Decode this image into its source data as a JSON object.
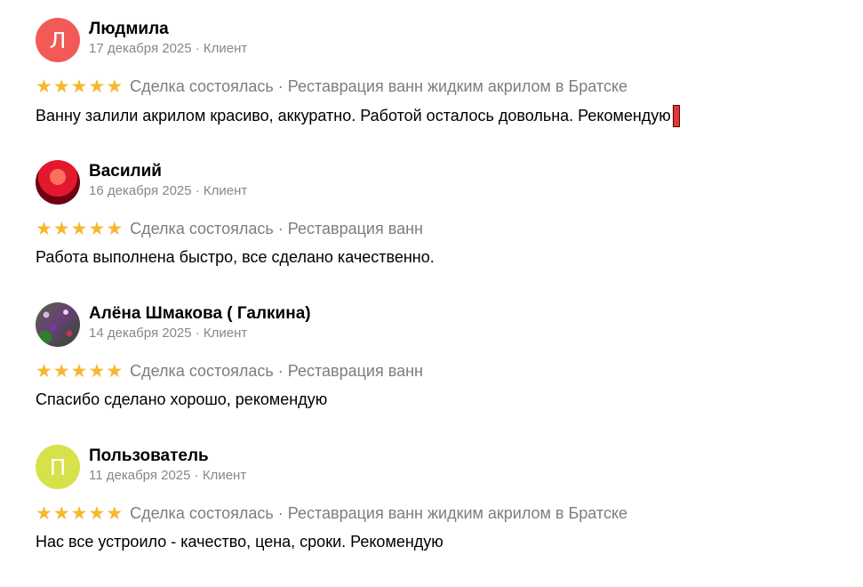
{
  "reviews": [
    {
      "avatar": {
        "type": "initial",
        "letter": "Л",
        "color": "#f25a57"
      },
      "author": "Людмила",
      "date": "17 декабря 2025",
      "role": "Клиент",
      "meta": "17 декабря 2025 · Клиент",
      "rating": 5,
      "stars": [
        "★",
        "★",
        "★",
        "★",
        "★"
      ],
      "deal": "Сделка состоялась · Реставрация ванн жидким акрилом в Братске",
      "text": "Ванну залили акрилом красиво, аккуратно. Работой осталось довольна. Рекомендую",
      "emoji": "red-exclamation-icon"
    },
    {
      "avatar": {
        "type": "photo",
        "icon": "user-photo-avatar",
        "color": "#d92029"
      },
      "author": "Василий",
      "date": "16 декабря 2025",
      "role": "Клиент",
      "meta": "16 декабря 2025 · Клиент",
      "rating": 5,
      "stars": [
        "★",
        "★",
        "★",
        "★",
        "★"
      ],
      "deal": "Сделка состоялась · Реставрация ванн",
      "text": "Работа выполнена быстро, все сделано качественно."
    },
    {
      "avatar": {
        "type": "photo",
        "icon": "flowers-photo-avatar",
        "color": "#5e7a3f"
      },
      "author": "Алёна Шмакова ( Галкина)",
      "date": "14 декабря 2025",
      "role": "Клиент",
      "meta": "14 декабря 2025 · Клиент",
      "rating": 5,
      "stars": [
        "★",
        "★",
        "★",
        "★",
        "★"
      ],
      "deal": "Сделка состоялась · Реставрация ванн",
      "text": "Спасибо сделано хорошо, рекомендую"
    },
    {
      "avatar": {
        "type": "initial",
        "letter": "П",
        "color": "#d7e24a"
      },
      "author": "Пользователь",
      "date": "11 декабря 2025",
      "role": "Клиент",
      "meta": "11 декабря 2025 · Клиент",
      "rating": 5,
      "stars": [
        "★",
        "★",
        "★",
        "★",
        "★"
      ],
      "deal": "Сделка состоялась · Реставрация ванн жидким акрилом в Братске",
      "text": "Нас все устроило - качество, цена, сроки. Рекомендую"
    }
  ],
  "colors": {
    "star": "#f6b82f",
    "meta_text": "#878787",
    "deal_text": "#7d7d7d",
    "body_text": "#000000"
  }
}
